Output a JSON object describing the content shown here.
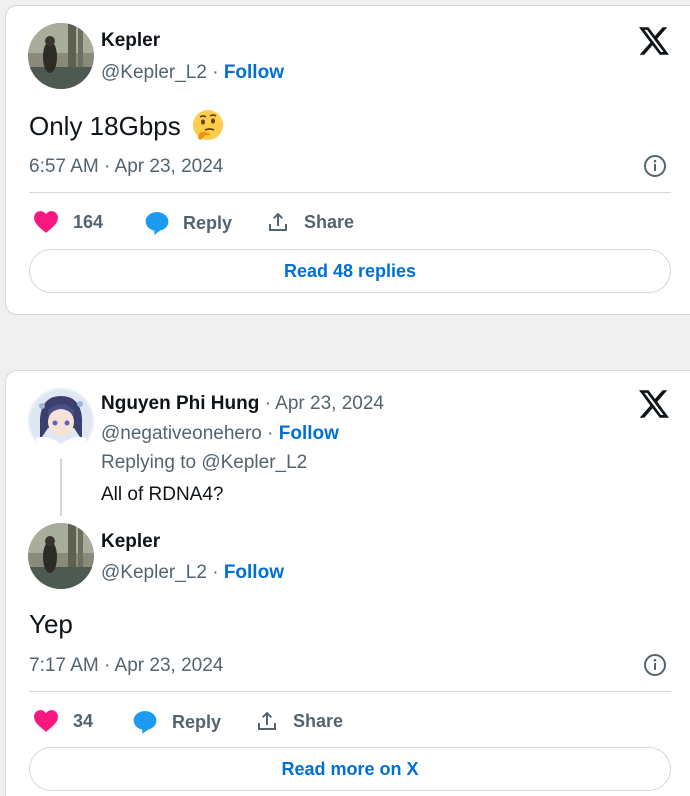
{
  "colors": {
    "link": "#006fd6",
    "like": "#f91880",
    "reply": "#1d9bf0",
    "secondary": "#536471"
  },
  "tweet1": {
    "author": {
      "name": "Kepler",
      "handle": "@Kepler_L2",
      "follow_label": "Follow",
      "separator": "·"
    },
    "text": "Only 18Gbps",
    "emoji": "thinking-face",
    "timestamp": "6:57 AM · Apr 23, 2024",
    "actions": {
      "likes": "164",
      "reply_label": "Reply",
      "share_label": "Share"
    },
    "read_replies_label": "Read 48 replies"
  },
  "tweet2": {
    "parent": {
      "name": "Nguyen Phi Hung",
      "date": "· Apr 23, 2024",
      "handle": "@negativeonehero",
      "follow_label": "Follow",
      "separator": "·",
      "replying_to": "Replying to @Kepler_L2",
      "text": "All of RDNA4?"
    },
    "author": {
      "name": "Kepler",
      "handle": "@Kepler_L2",
      "follow_label": "Follow",
      "separator": "·"
    },
    "text": "Yep",
    "timestamp": "7:17 AM · Apr 23, 2024",
    "actions": {
      "likes": "34",
      "reply_label": "Reply",
      "share_label": "Share"
    },
    "read_more_label": "Read more on X"
  }
}
